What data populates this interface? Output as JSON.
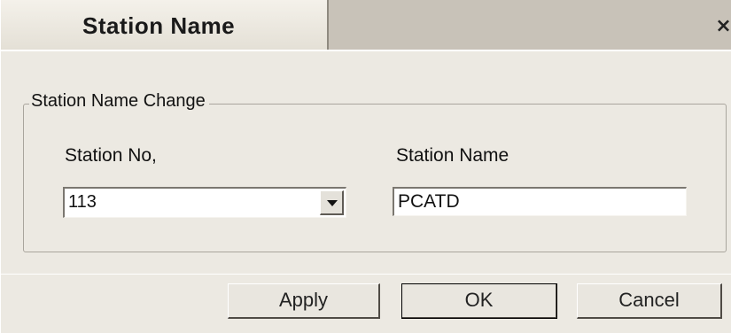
{
  "window": {
    "title": "Station Name",
    "close_icon": "close-icon",
    "close_glyph": "×"
  },
  "group": {
    "legend": "Station Name Change",
    "station_no_label": "Station No,",
    "station_name_label": "Station Name",
    "station_no_value": "113",
    "station_name_value": "PCATD"
  },
  "buttons": {
    "apply": "Apply",
    "ok": "OK",
    "cancel": "Cancel"
  }
}
